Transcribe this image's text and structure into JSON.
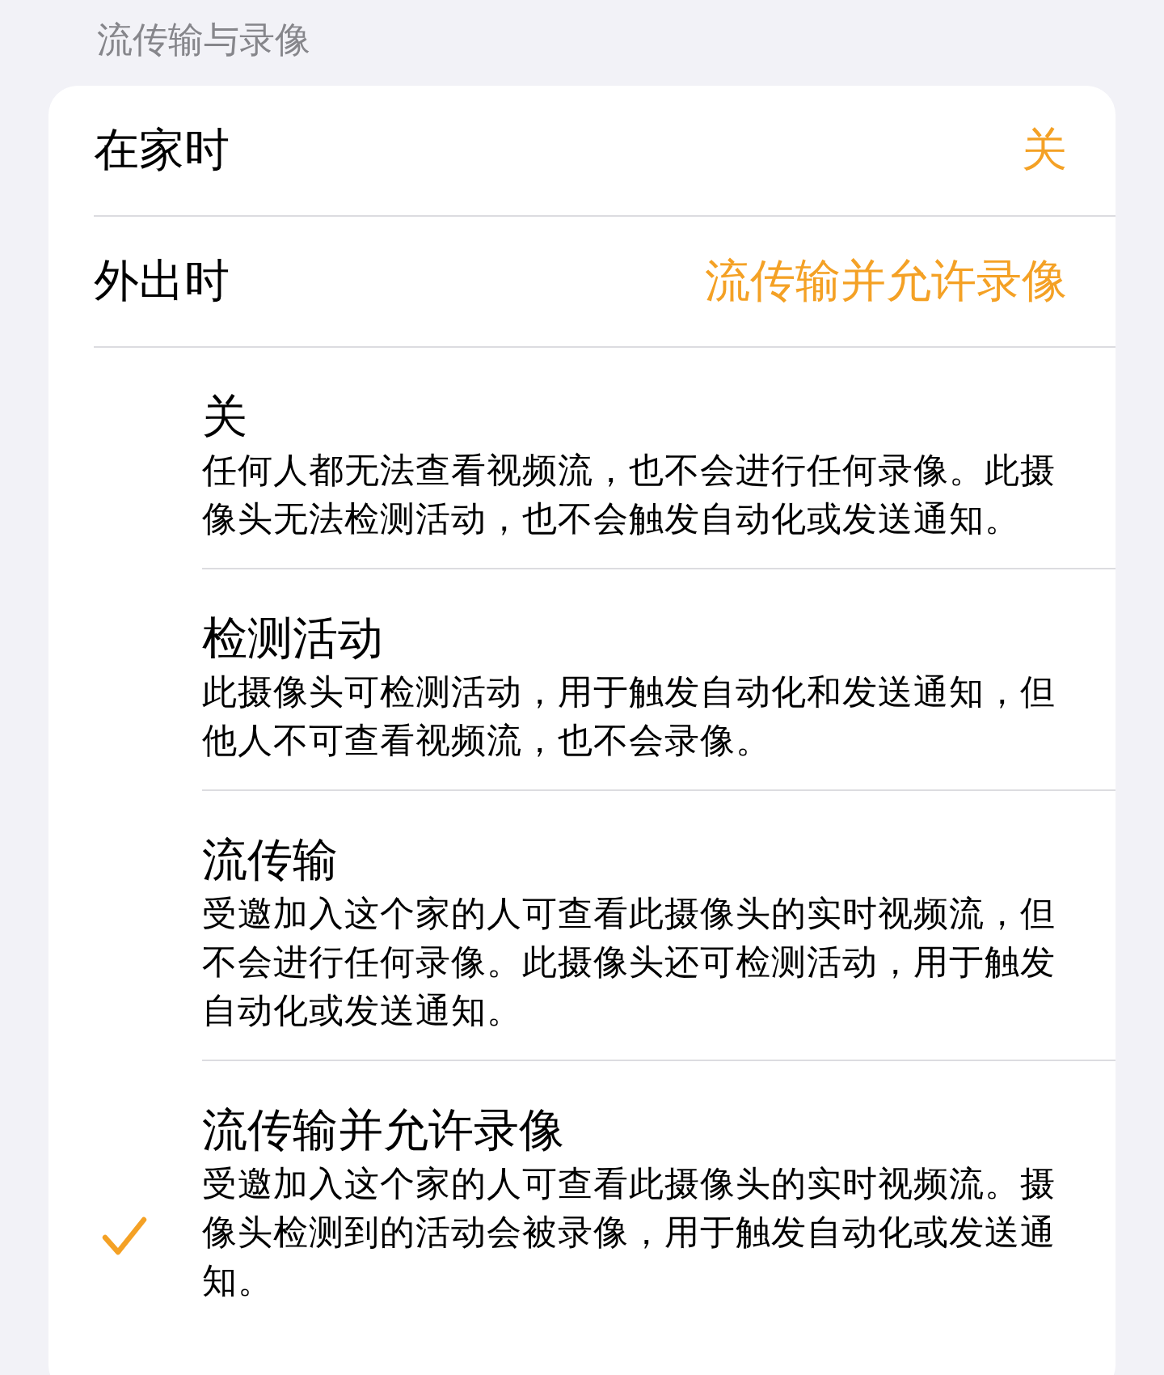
{
  "section_title": "流传输与录像",
  "rows": [
    {
      "label": "在家时",
      "value": "关"
    },
    {
      "label": "外出时",
      "value": "流传输并允许录像"
    }
  ],
  "options": [
    {
      "title": "关",
      "description": "任何人都无法查看视频流，也不会进行任何录像。此摄像头无法检测活动，也不会触发自动化或发送通知。",
      "selected": false
    },
    {
      "title": "检测活动",
      "description": "此摄像头可检测活动，用于触发自动化和发送通知，但他人不可查看视频流，也不会录像。",
      "selected": false
    },
    {
      "title": "流传输",
      "description": "受邀加入这个家的人可查看此摄像头的实时视频流，但不会进行任何录像。此摄像头还可检测活动，用于触发自动化或发送通知。",
      "selected": false
    },
    {
      "title": "流传输并允许录像",
      "description": "受邀加入这个家的人可查看此摄像头的实时视频流。摄像头检测到的活动会被录像，用于触发自动化或发送通知。",
      "selected": true
    }
  ]
}
